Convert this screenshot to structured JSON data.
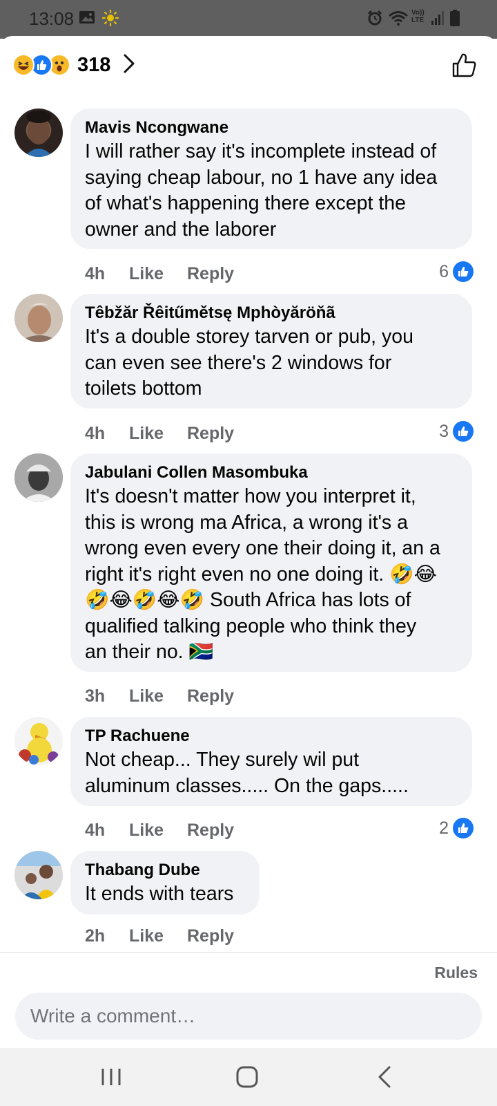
{
  "status_bar": {
    "time": "13:08",
    "icons": [
      "image-icon",
      "sun-icon",
      "alarm-icon",
      "wifi-icon",
      "volte-icon",
      "signal-icon",
      "battery-icon"
    ],
    "volte_text": "Vo)) LTE"
  },
  "reactions": {
    "icons": [
      "haha-emoji-icon",
      "like-reaction-icon",
      "wow-emoji-icon"
    ],
    "count": "318"
  },
  "comments": [
    {
      "name": "Mavis Ncongwane",
      "lines": [
        "I will rather say it's incomplete instead of",
        "saying cheap labour, no 1 have any idea",
        "of what's happening there except the",
        "owner and the laborer"
      ],
      "time": "4h",
      "like_label": "Like",
      "reply_label": "Reply",
      "likes": "6"
    },
    {
      "name": "Têbžăr Řêitűmětsę Mphòyăröňã",
      "lines": [
        "It's a double storey tarven or pub, you",
        "can even see there's 2 windows for",
        "toilets bottom"
      ],
      "time": "4h",
      "like_label": "Like",
      "reply_label": "Reply",
      "likes": "3"
    },
    {
      "name": "Jabulani Collen Masombuka",
      "lines": [
        "It's doesn't matter how you interpret it,",
        "this is wrong ma Africa, a wrong it's a",
        "wrong even every one their doing it, an a",
        "right it's right even no one doing it. 🤣😂",
        "🤣😂🤣😂🤣 South Africa has lots of",
        "qualified talking people who think they",
        "an their no. 🇿🇦"
      ],
      "time": "3h",
      "like_label": "Like",
      "reply_label": "Reply",
      "likes": ""
    },
    {
      "name": "TP Rachuene",
      "lines": [
        "Not cheap... They surely wil put",
        "aluminum classes..... On the gaps....."
      ],
      "time": "4h",
      "like_label": "Like",
      "reply_label": "Reply",
      "likes": "2"
    },
    {
      "name": "Thabang Dube",
      "lines": [
        "It ends with tears"
      ],
      "time": "2h",
      "like_label": "Like",
      "reply_label": "Reply",
      "likes": ""
    }
  ],
  "footer": {
    "rules_label": "Rules",
    "comment_placeholder": "Write a comment…"
  },
  "nav": {
    "icons": [
      "recent-apps-icon",
      "home-icon",
      "back-icon"
    ]
  },
  "colors": {
    "bubble": "#f0f2f5",
    "like_blue": "#1877f2",
    "meta_gray": "#65676b"
  }
}
